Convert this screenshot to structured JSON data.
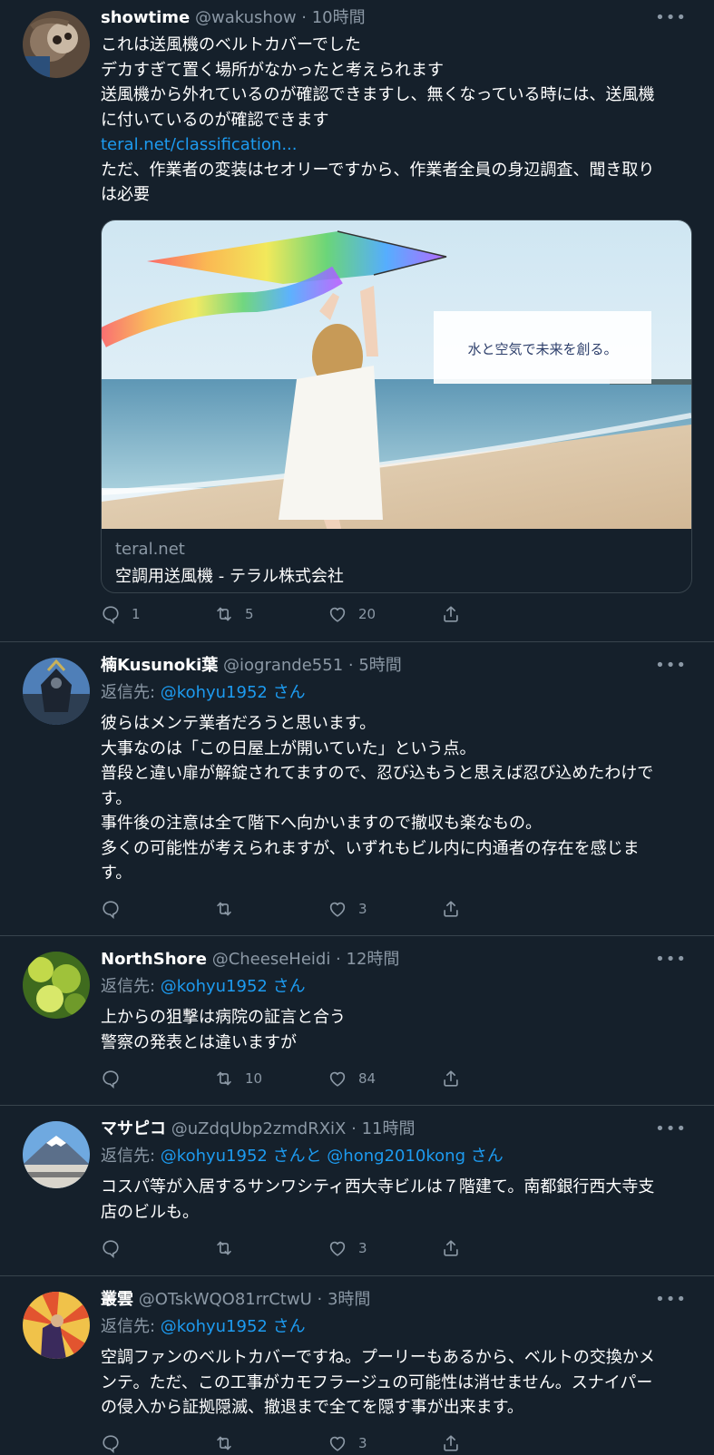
{
  "tweets": [
    {
      "name": "showtime",
      "handle": "@wakushow",
      "time": "10時間",
      "more": "•••",
      "body_lines": [
        "これは送風機のベルトカバーでした",
        "デカすぎて置く場所がなかったと考えられます",
        "送風機から外れているのが確認できますし、無くなっている時には、送風機",
        "に付いているのが確認できます",
        "teral.net/classification...",
        "ただ、作業者の変装はセオリーですから、作業者全員の身辺調査、聞き取り",
        "は必要"
      ],
      "card": {
        "image_text": "水と空気で未来を創る。",
        "domain": "teral.net",
        "title": "空調用送風機 - テラル株式会社"
      },
      "actions": {
        "reply": "1",
        "retweet": "5",
        "like": "20"
      }
    },
    {
      "name": "楠Kusunoki葉",
      "handle": "@iogrande551",
      "time": "5時間",
      "more": "•••",
      "reply_prefix": "返信先: ",
      "reply_to": "@kohyu1952 さん",
      "body_lines": [
        "彼らはメンテ業者だろうと思います。",
        "大事なのは「この日屋上が開いていた」という点。",
        "普段と違い扉が解錠されてますので、忍び込もうと思えば忍び込めたわけで",
        "す。",
        "事件後の注意は全て階下へ向かいますので撤収も楽なもの。",
        "多くの可能性が考えられますが、いずれもビル内に内通者の存在を感じま",
        "す。"
      ],
      "actions": {
        "reply": "",
        "retweet": "",
        "like": "3"
      }
    },
    {
      "name": "NorthShore",
      "handle": "@CheeseHeidi",
      "time": "12時間",
      "more": "•••",
      "reply_prefix": "返信先: ",
      "reply_to": "@kohyu1952 さん",
      "body_lines": [
        "上からの狙撃は病院の証言と合う",
        "警察の発表とは違いますが"
      ],
      "actions": {
        "reply": "",
        "retweet": "10",
        "like": "84"
      }
    },
    {
      "name": "マサピコ",
      "handle": "@uZdqUbp2zmdRXiX",
      "time": "11時間",
      "more": "•••",
      "reply_prefix": "返信先: ",
      "reply_to": "@kohyu1952 さんと @hong2010kong さん",
      "body_lines": [
        "コスパ等が入居するサンワシティ西大寺ビルは７階建て。南都銀行西大寺支",
        "店のビルも。"
      ],
      "actions": {
        "reply": "",
        "retweet": "",
        "like": "3"
      }
    },
    {
      "name": "叢雲",
      "handle": "@OTskWQO81rrCtwU",
      "time": "3時間",
      "more": "•••",
      "reply_prefix": "返信先: ",
      "reply_to": "@kohyu1952 さん",
      "body_lines": [
        "空調ファンのベルトカバーですね。プーリーもあるから、ベルトの交換かメ",
        "ンテ。ただ、この工事がカモフラージュの可能性は消せません。スナイパー",
        "の侵入から証拠隠滅、撤退まで全てを隠す事が出来ます。"
      ],
      "actions": {
        "reply": "",
        "retweet": "",
        "like": "3"
      }
    }
  ],
  "colors": {
    "background": "#15202b",
    "text": "#ffffff",
    "secondary": "#8b98a5",
    "link": "#1d9bf0",
    "divider": "#38444d"
  },
  "icons": [
    "reply-icon",
    "retweet-icon",
    "like-icon",
    "share-icon"
  ]
}
